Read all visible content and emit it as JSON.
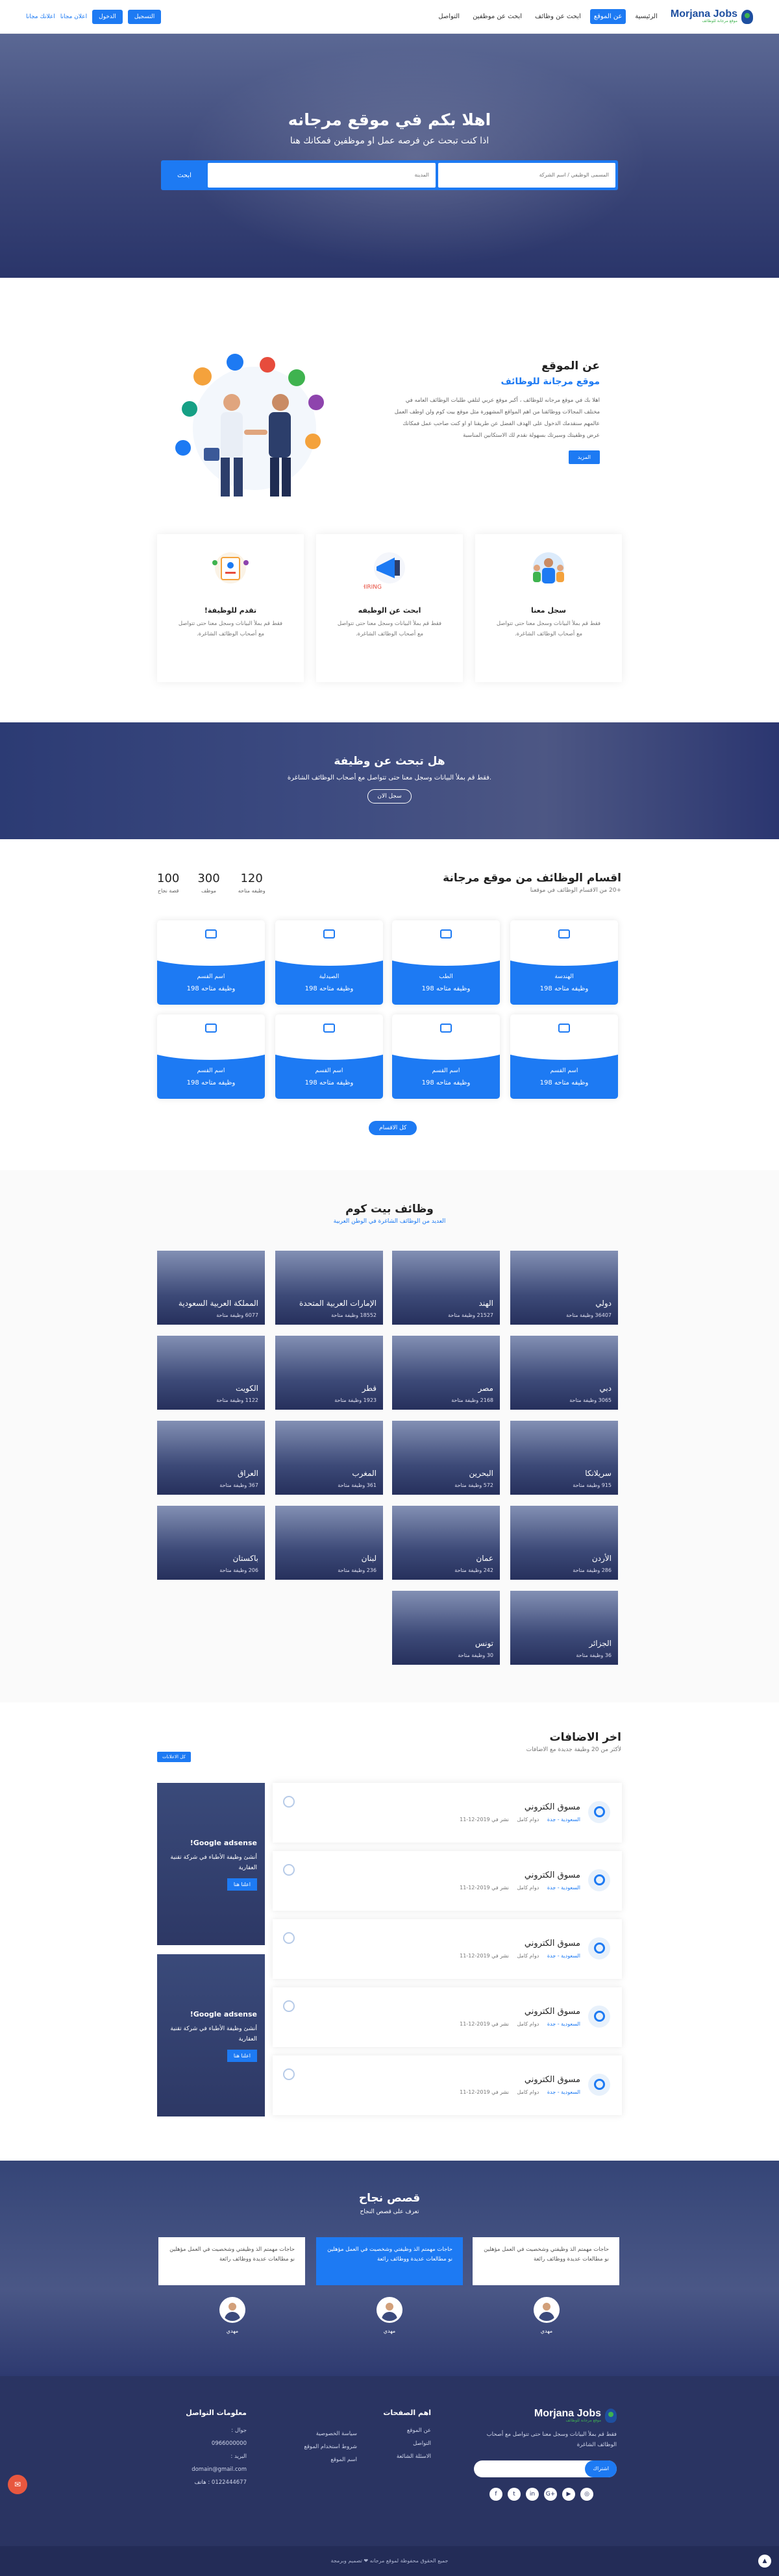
{
  "nav": {
    "logo": "Morjana Jobs",
    "logo_sub": "موقع مرجانة للوظائف",
    "links": [
      "الرئيسية",
      "عن الموقع",
      "ابحث عن وظائف",
      "ابحث عن موظفين",
      "التواصل"
    ],
    "register": "التسجيل",
    "login": "الدخول",
    "post_free": "اعلان مجانا",
    "free_link": "اعلانك مجانا"
  },
  "hero": {
    "title": "اهلا بكم في موقع مرجانه",
    "subtitle": "اذا كنت تبحث عن فرصه عمل او موظفين فمكانك هنا",
    "field1": "المسمى الوظيفي / اسم الشركة",
    "field2": "المدينة",
    "search": "ابحث"
  },
  "about": {
    "title": "عن الموقع",
    "subtitle": "موقع مرجانة للوظائف",
    "text": "اهلا بك في موقع مرجانه للوظائف ، أكبر موقع عربي لتلقي طلبات الوظائف العامه في مختلف المجالات ووظائفنا من اهم المواقع المشهورة مثل موقع بيت كوم ولن اوظف العمل عالمهم سنقدمك الدخول على الهدف الفضل عن طريقنا او او كنت صاحب عمل فمكانك عرض وظفيتك وسيرتك بسهولة نقدم لك الاستكانين المناسبة",
    "more": "المزيد"
  },
  "features": [
    {
      "title": "سجل معنا",
      "text": "فقط قم بملأ البيانات وسجل معنا حتى تتواصل مع أصحاب الوظائف الشاغرة."
    },
    {
      "title": "ابحث عن الوظيفه",
      "text": "فقط قم بملأ البيانات وسجل معنا حتى تتواصل مع أصحاب الوظائف الشاغرة."
    },
    {
      "title": "تقدم للوظيفة!",
      "text": "فقط قم بملأ البيانات وسجل معنا حتى تتواصل مع أصحاب الوظائف الشاغرة."
    }
  ],
  "banner": {
    "title": "هل تبحث عن وظيفة",
    "text": "فقط قم بملأ البيانات وسجل معنا حتى تتواصل مع أصحاب الوظائف الشاغرة.",
    "button": "سجل الان"
  },
  "categories": {
    "title": "اقسام الوظائف من موقع مرجانة",
    "subtitle": "+20 من الاقسام الوظائف في موقعنا",
    "stats": [
      {
        "value": "120",
        "label": "وظيفه متاحه"
      },
      {
        "value": "300",
        "label": "موظف"
      },
      {
        "value": "100",
        "label": "قصة نجاح"
      }
    ],
    "items": [
      {
        "name": "الهندسة",
        "count": "198 وظيفه متاحه"
      },
      {
        "name": "الطب",
        "count": "198 وظيفه متاحه"
      },
      {
        "name": "الصيدلية",
        "count": "198 وظيفه متاحه"
      },
      {
        "name": "اسم القسم",
        "count": "198 وظيفه متاحه"
      },
      {
        "name": "اسم القسم",
        "count": "198 وظيفه متاحه"
      },
      {
        "name": "اسم القسم",
        "count": "198 وظيفه متاحه"
      },
      {
        "name": "اسم القسم",
        "count": "198 وظيفه متاحه"
      },
      {
        "name": "اسم القسم",
        "count": "198 وظيفه متاحه"
      }
    ],
    "all": "كل الاقسام"
  },
  "countries": {
    "title": "وظائف بيت كوم",
    "subtitle": "العديد من الوظائف الشاغرة في الوطن العربية",
    "items": [
      {
        "name": "دولي",
        "count": "36407 وظيفة متاحة"
      },
      {
        "name": "الهند",
        "count": "21527 وظيفة متاحة"
      },
      {
        "name": "الإمارات العربية المتحدة",
        "count": "18552 وظيفة متاحة"
      },
      {
        "name": "المملكة العربية السعودية",
        "count": "6077 وظيفة متاحة"
      },
      {
        "name": "دبي",
        "count": "3065 وظيفة متاحة"
      },
      {
        "name": "مصر",
        "count": "2168 وظيفة متاحة"
      },
      {
        "name": "قطر",
        "count": "1923 وظيفة متاحة"
      },
      {
        "name": "الكويت",
        "count": "1122 وظيفة متاحة"
      },
      {
        "name": "سريلانكا",
        "count": "915 وظيفة متاحة"
      },
      {
        "name": "البحرين",
        "count": "572 وظيفة متاحة"
      },
      {
        "name": "المغرب",
        "count": "361 وظيفة متاحة"
      },
      {
        "name": "العراق",
        "count": "367 وظيفة متاحة"
      },
      {
        "name": "الأردن",
        "count": "286 وظيفة متاحة"
      },
      {
        "name": "عمان",
        "count": "242 وظيفة متاحة"
      },
      {
        "name": "لبنان",
        "count": "236 وظيفة متاحة"
      },
      {
        "name": "باكستان",
        "count": "206 وظيفة متاحة"
      },
      {
        "name": "الجزائر",
        "count": "36 وظيفة متاحة"
      },
      {
        "name": "تونس",
        "count": "30 وظيفة متاحة"
      }
    ]
  },
  "latest": {
    "title": "اخر الاضافات",
    "subtitle": "لأكثر من 20 وظيفة جديدة مع الاضافات",
    "all": "كل الاعلانات",
    "jobs": [
      {
        "title": "مسوق الكتروني",
        "loc": "السعودية - جدة",
        "type": "دوام كامل",
        "date": "نشر في 2019-12-11"
      },
      {
        "title": "مسوق الكتروني",
        "loc": "السعودية - جدة",
        "type": "دوام كامل",
        "date": "نشر في 2019-12-11"
      },
      {
        "title": "مسوق الكتروني",
        "loc": "السعودية - جدة",
        "type": "دوام كامل",
        "date": "نشر في 2019-12-11"
      },
      {
        "title": "مسوق الكتروني",
        "loc": "السعودية - جدة",
        "type": "دوام كامل",
        "date": "نشر في 2019-12-11"
      },
      {
        "title": "مسوق الكتروني",
        "loc": "السعودية - جدة",
        "type": "دوام كامل",
        "date": "نشر في 2019-12-11"
      }
    ],
    "ads": [
      {
        "title": "Google adsense!",
        "text": "أنشئ وظيفة الأطباء في شركة تقنية العقارية",
        "button": "اعلنا هنا"
      },
      {
        "title": "Google adsense!",
        "text": "أنشئ وظيفة الأطباء في شركة تقنية العقارية",
        "button": "اعلنا هنا"
      }
    ]
  },
  "success": {
    "title": "قصص نجاح",
    "subtitle": "تعرف على قصص النجاح",
    "cards": [
      {
        "text": "حاجات مهمتم الذ وظيفتي وشخصيت في العمل مؤهلين نو مطالعات عديدة ووظائف رائعة",
        "name": "مهدي"
      },
      {
        "text": "حاجات مهمتم الذ وظيفتي وشخصيت في العمل مؤهلين نو مطالعات عديدة ووظائف رائعة",
        "name": "مهدي"
      },
      {
        "text": "حاجات مهمتم الذ وظيفتي وشخصيت في العمل مؤهلين نو مطالعات عديدة ووظائف رائعة",
        "name": "مهدي"
      }
    ]
  },
  "footer": {
    "about": "فقط قم بملأ البيانات وسجل معنا حتى تتواصل مع أصحاب الوظائف الشاغرة",
    "newsletter": "اشتراك",
    "pages_title": "اهم الصفحات",
    "pages": [
      "عن الموقع",
      "التواصل",
      "الاسئلة الشائعة"
    ],
    "pages2": [
      "سياسة الخصوصية",
      "شروط استخدام الموقع",
      "اسم الموقع"
    ],
    "contact_title": "معلومات التواصل",
    "contact": [
      "جوال :",
      "0966000000",
      "البريد :",
      "domain@gmail.com",
      "0122444677 : هاتف"
    ],
    "social": [
      "f",
      "t",
      "in",
      "G+",
      "▶",
      "◎"
    ],
    "copyright": "جميع الحقوق محفوظة لموقع مرجانه ❤ تصميم وبرمجة"
  }
}
